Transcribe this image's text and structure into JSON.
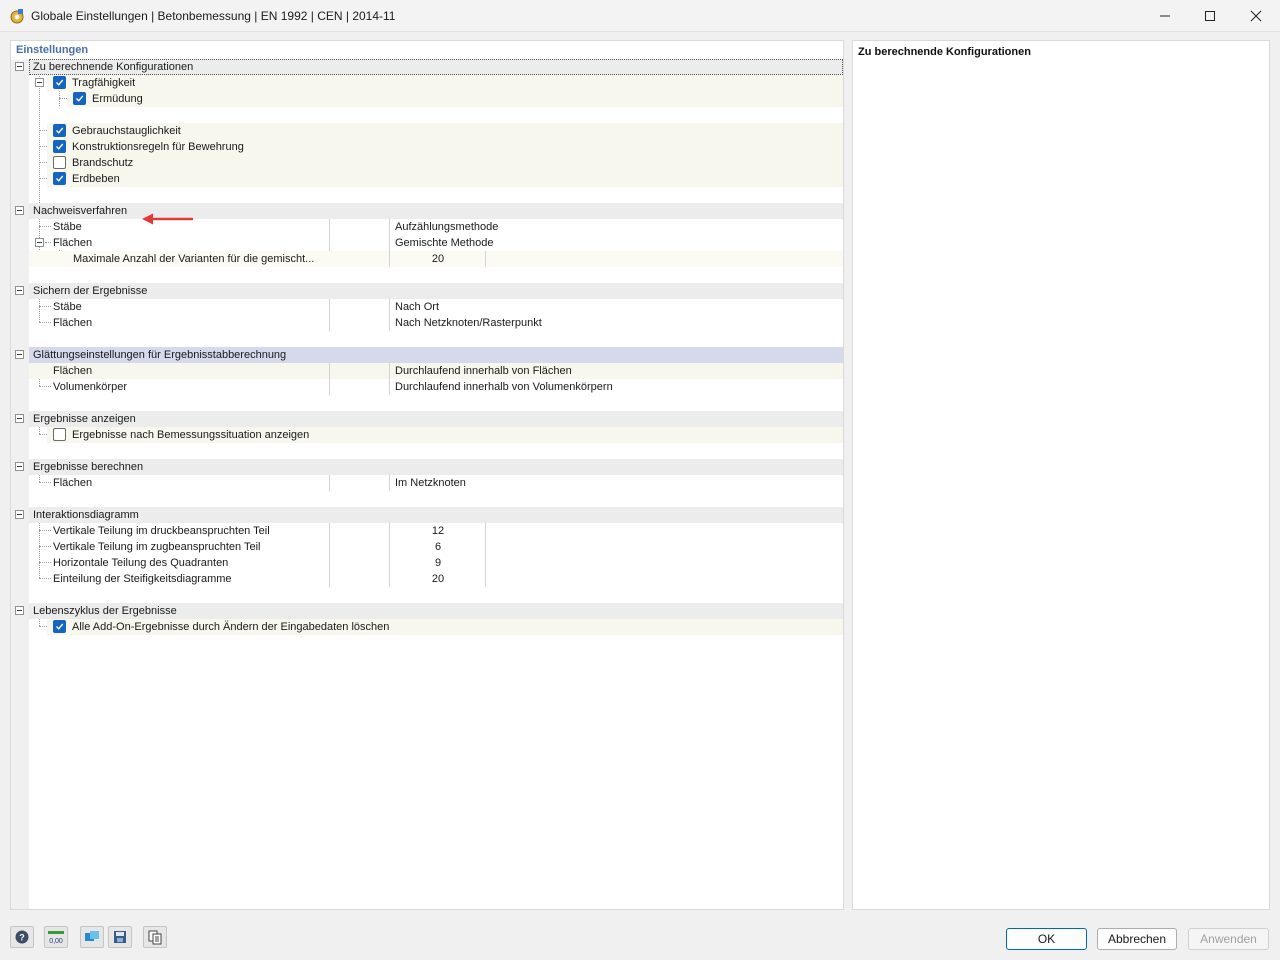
{
  "window": {
    "title": "Globale Einstellungen | Betonbemessung | EN 1992 | CEN | 2014-11"
  },
  "pane": {
    "header": "Einstellungen"
  },
  "description": {
    "title": "Zu berechnende Konfigurationen"
  },
  "config": {
    "title": "Zu berechnende Konfigurationen",
    "items": [
      {
        "label": "Tragfähigkeit",
        "checked": true
      },
      {
        "label": "Ermüdung",
        "checked": true
      },
      {
        "label": "Gebrauchstauglichkeit",
        "checked": true
      },
      {
        "label": "Konstruktionsregeln für Bewehrung",
        "checked": true
      },
      {
        "label": "Brandschutz",
        "checked": false
      },
      {
        "label": "Erdbeben",
        "checked": true
      }
    ]
  },
  "nachweis": {
    "title": "Nachweisverfahren",
    "staebe": {
      "label": "Stäbe",
      "value": "Aufzählungsmethode"
    },
    "flaechen": {
      "label": "Flächen",
      "value": "Gemischte Methode"
    },
    "max": {
      "label": "Maximale Anzahl der Varianten für die gemischt...",
      "value": "20"
    }
  },
  "sichern": {
    "title": "Sichern der Ergebnisse",
    "staebe": {
      "label": "Stäbe",
      "value": "Nach Ort"
    },
    "flaechen": {
      "label": "Flächen",
      "value": "Nach Netzknoten/Rasterpunkt"
    }
  },
  "glaettung": {
    "title": "Glättungseinstellungen für Ergebnisstabberechnung",
    "flaechen": {
      "label": "Flächen",
      "value": "Durchlaufend innerhalb von Flächen"
    },
    "volumen": {
      "label": "Volumenkörper",
      "value": "Durchlaufend innerhalb von Volumenkörpern"
    }
  },
  "anzeigen": {
    "title": "Ergebnisse anzeigen",
    "item": {
      "label": "Ergebnisse nach Bemessungssituation anzeigen",
      "checked": false
    }
  },
  "berechnen": {
    "title": "Ergebnisse berechnen",
    "flaechen": {
      "label": "Flächen",
      "value": "Im Netzknoten"
    }
  },
  "interaktion": {
    "title": "Interaktionsdiagramm",
    "druck": {
      "label": "Vertikale Teilung im druckbeanspruchten Teil",
      "value": "12"
    },
    "zug": {
      "label": "Vertikale Teilung im zugbeanspruchten Teil",
      "value": "6"
    },
    "quad": {
      "label": "Horizontale Teilung des Quadranten",
      "value": "9"
    },
    "steif": {
      "label": "Einteilung der Steifigkeitsdiagramme",
      "value": "20"
    }
  },
  "lebens": {
    "title": "Lebenszyklus der Ergebnisse",
    "item": {
      "label": "Alle Add-On-Ergebnisse durch Ändern der Eingabedaten löschen",
      "checked": true
    }
  },
  "buttons": {
    "ok": "OK",
    "cancel": "Abbrechen",
    "apply": "Anwenden"
  },
  "toolbar": {
    "units_label": "0,00"
  },
  "colors": {
    "accent": "#1565c0",
    "arrow": "#e03a3a",
    "header": "#4a6ea8"
  }
}
